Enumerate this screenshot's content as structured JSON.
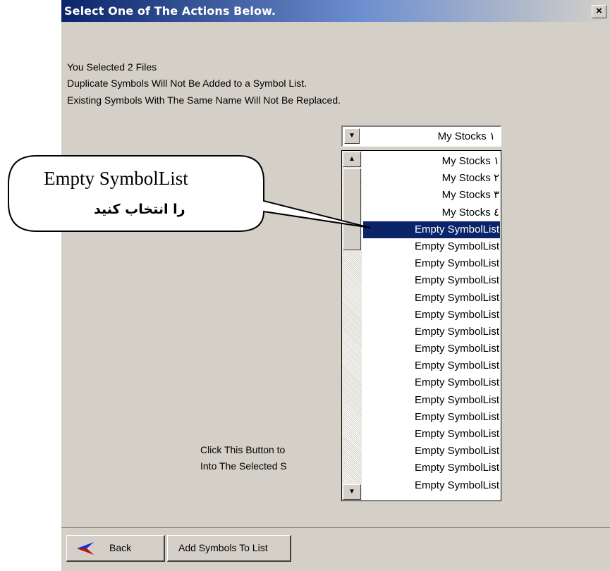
{
  "window": {
    "title": "Select One of The Actions Below.",
    "close_glyph": "×"
  },
  "message": {
    "line1": "You Selected 2 Files",
    "line2": "Duplicate Symbols Will Not Be Added to a Symbol List.",
    "line3": "Existing Symbols With The Same Name Will Not Be Replaced."
  },
  "symbol_list_combo": {
    "selected_value": "My Stocks ١",
    "open": true,
    "scrollbar": {
      "up_icon": "arrow-up-icon",
      "down_icon": "arrow-down-icon"
    },
    "options": [
      "My Stocks ١",
      "My Stocks ٢",
      "My Stocks ٣",
      "My Stocks ٤",
      "Empty SymbolList",
      "Empty SymbolList",
      "Empty SymbolList",
      "Empty SymbolList",
      "Empty SymbolList",
      "Empty SymbolList",
      "Empty SymbolList",
      "Empty SymbolList",
      "Empty SymbolList",
      "Empty SymbolList",
      "Empty SymbolList",
      "Empty SymbolList",
      "Empty SymbolList",
      "Empty SymbolList",
      "Empty SymbolList",
      "Empty SymbolList"
    ],
    "highlighted_index": 4
  },
  "hint": {
    "line1": "Click This Button to",
    "line2": "Into The Selected S"
  },
  "buttons": {
    "back_label": "Back",
    "add_label": "Add Symbols To List",
    "back_icon": "back-arrow-icon"
  },
  "callout": {
    "line1": "Empty SymbolList",
    "line2": "را انتخاب کنید"
  },
  "colors": {
    "title_bar": "#0a246a",
    "window_bg": "#d4d0c8",
    "selection": "#0a246a",
    "back_arrow": "#1a2fd6"
  }
}
